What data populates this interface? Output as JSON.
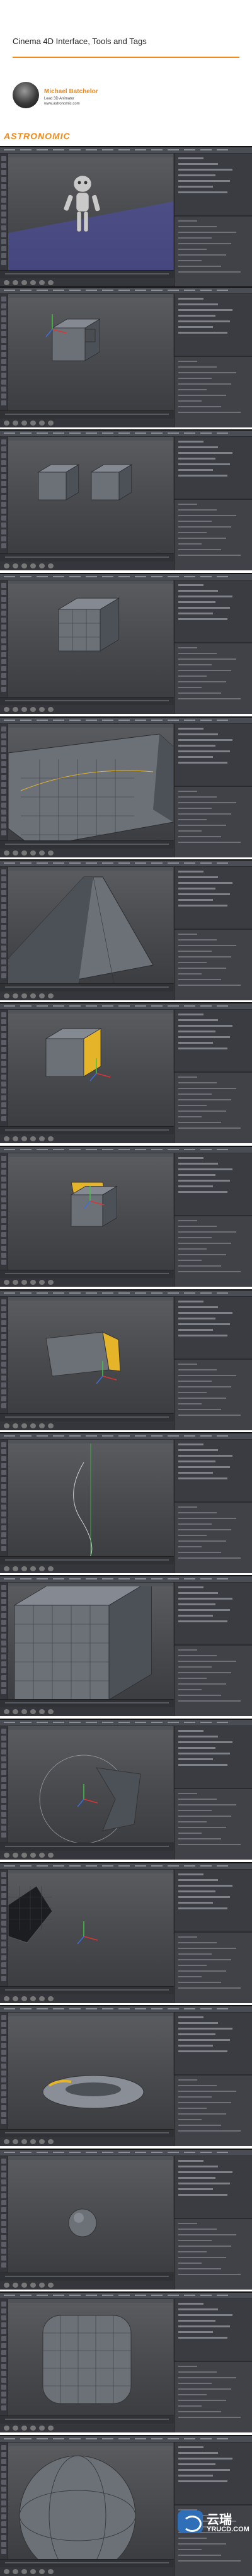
{
  "header": {
    "title": "Cinema 4D Interface, Tools and Tags",
    "author": "Michael Batchelor",
    "role": "Lead 3D Animator",
    "site": "www.astronomic.com",
    "brand": "ASTRONOMIC"
  },
  "screenshots": [
    {
      "scene": "Robot character standing in viewport"
    },
    {
      "scene": "Cube with selected green face"
    },
    {
      "scene": "Two cubes side by side"
    },
    {
      "scene": "Subdivided cube, edges visible"
    },
    {
      "scene": "Large extruded box, close view"
    },
    {
      "scene": "Tapered extruded shape"
    },
    {
      "scene": "Cube with yellow selected face"
    },
    {
      "scene": "Small cube with yellow top face"
    },
    {
      "scene": "Extruded cube with yellow face"
    },
    {
      "scene": "Spline path drawn in space"
    },
    {
      "scene": "Large subdivided cube, close view"
    },
    {
      "scene": "Circle primitive with deformed cube"
    },
    {
      "scene": "Dark cube tilted with green axis"
    },
    {
      "scene": "Torus with yellow highlight"
    },
    {
      "scene": "Sphere primitive"
    },
    {
      "scene": "Subdivided rounded cube"
    },
    {
      "scene": "Rounded sphere, close view"
    }
  ],
  "watermark": {
    "cn": "云瑞",
    "en": "YRUCD.COM"
  },
  "colors": {
    "accent": "#f28a1a",
    "ui_dark": "#3c3f45",
    "selection_yellow": "#e6b428",
    "axis_green": "#3fc63f"
  }
}
